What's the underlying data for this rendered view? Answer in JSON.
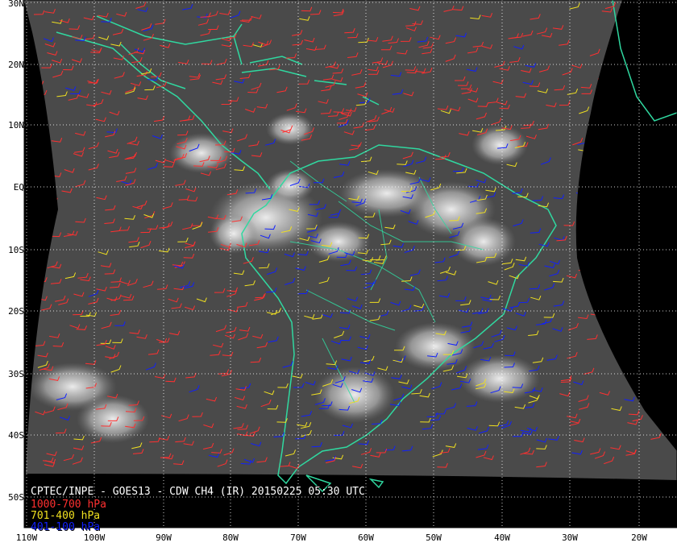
{
  "map": {
    "caption": "CPTEC/INPE - GOES13 - CDW CH4 (IR) 20150225 05:30 UTC",
    "legend": [
      {
        "label": "1000-700 hPa",
        "color": "#ff3030"
      },
      {
        "label": "701-400 hPa",
        "color": "#f0e020"
      },
      {
        "label": "401-100 hPa",
        "color": "#1020ff"
      }
    ],
    "colors": {
      "coastline": "#30d8a0",
      "grid": "#ffffff",
      "space": "#000000",
      "background": "#ffffff"
    },
    "lat_labels": [
      "30N",
      "20N",
      "10N",
      "EQ",
      "10S",
      "20S",
      "30S",
      "40S",
      "50S"
    ],
    "lon_labels": [
      "110W",
      "100W",
      "90W",
      "80W",
      "70W",
      "60W",
      "50W",
      "40W",
      "30W",
      "20W"
    ]
  }
}
